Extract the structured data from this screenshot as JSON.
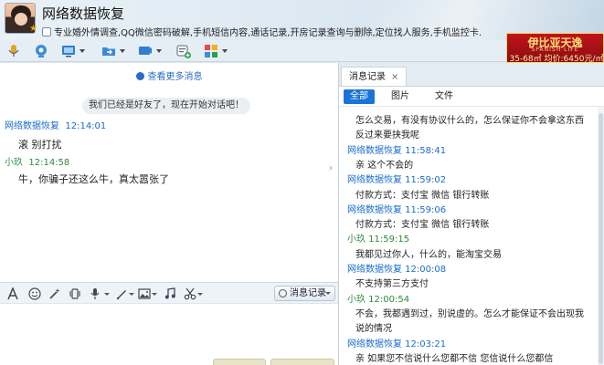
{
  "header": {
    "contact_name": "网络数据恢复",
    "signature": "专业婚外情调查,QQ微信密码破解,手机短信内容,通话记录,开房记录查询与删除,定位找人服务,手机监控卡."
  },
  "ad": {
    "brand": "伊比亚天逸",
    "sub": "SPANISH LIFE",
    "price": "35-68㎡ 均价:6450元/㎡"
  },
  "chat": {
    "more_link": "查看更多消息",
    "system_msg": "我们已经是好友了，现在开始对话吧！",
    "messages": [
      {
        "sender": "网络数据恢复",
        "time": "12:14:01",
        "text": "滚 别打扰"
      },
      {
        "sender": "小玖",
        "time": "12:14:58",
        "text": "牛，你骗子还这么牛，真太嚣张了"
      }
    ]
  },
  "input_toolbar": {
    "history_button": "消息记录"
  },
  "history": {
    "tab_label": "消息记录",
    "filters": [
      "全部",
      "图片",
      "文件"
    ],
    "lines": [
      {
        "kind": "text",
        "text": "怎么交易，有没有协议什么的，怎么保证你不会拿这东西"
      },
      {
        "kind": "text",
        "text": "反过来要挟我呢"
      },
      {
        "kind": "friend",
        "text": "网络数据恢复 11:58:41"
      },
      {
        "kind": "text",
        "text": "亲 这个不会的"
      },
      {
        "kind": "friend",
        "text": "网络数据恢复 11:59:02"
      },
      {
        "kind": "text",
        "text": "付款方式：支付宝 微信 银行转账"
      },
      {
        "kind": "friend",
        "text": "网络数据恢复 11:59:06"
      },
      {
        "kind": "text",
        "text": "付款方式：支付宝 微信 银行转账"
      },
      {
        "kind": "me",
        "text": "小玖 11:59:15"
      },
      {
        "kind": "text",
        "text": "我都见过你人，什么的，能淘宝交易"
      },
      {
        "kind": "friend",
        "text": "网络数据恢复 12:00:08"
      },
      {
        "kind": "text",
        "text": "不支持第三方支付"
      },
      {
        "kind": "me",
        "text": "小玖 12:00:54"
      },
      {
        "kind": "text",
        "text": "不会，我都遇到过，别说虚的。怎么才能保证不会出现我"
      },
      {
        "kind": "text",
        "text": "说的情况"
      },
      {
        "kind": "friend",
        "text": "网络数据恢复 12:03:21"
      },
      {
        "kind": "text",
        "text": "亲 如果您不信说什么您都不信 您信说什么您都信"
      }
    ]
  },
  "colors": {
    "link_blue": "#1a6bd1",
    "self_green": "#2e8b3a",
    "tab_active": "#1a73d9",
    "ad_red": "#c0141a"
  }
}
